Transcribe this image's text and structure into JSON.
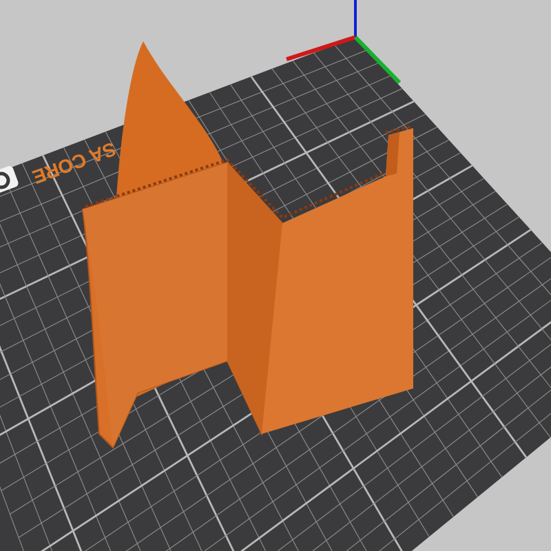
{
  "viewport": {
    "bed_label": "SA CORE"
  }
}
